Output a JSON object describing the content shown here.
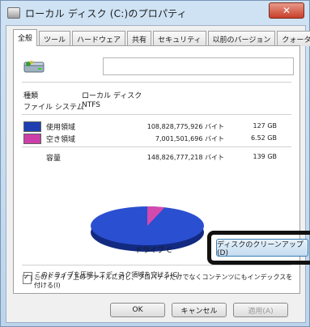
{
  "window": {
    "title": "ローカル ディスク (C:)のプロパティ",
    "close_label": "✕"
  },
  "tabs": [
    {
      "label": "全般",
      "active": true
    },
    {
      "label": "ツール",
      "active": false
    },
    {
      "label": "ハードウェア",
      "active": false
    },
    {
      "label": "共有",
      "active": false
    },
    {
      "label": "セキュリティ",
      "active": false
    },
    {
      "label": "以前のバージョン",
      "active": false
    },
    {
      "label": "クォータ",
      "active": false
    }
  ],
  "general": {
    "name_value": "",
    "type_label": "種類",
    "type_value": "ローカル ディスク",
    "fs_label": "ファイル システム",
    "fs_value": "NTFS",
    "used": {
      "label": "使用領域",
      "bytes": "108,828,775,926 バイト",
      "size": "127 GB",
      "color": "#1f3fb0"
    },
    "free": {
      "label": "空き領域",
      "bytes": "7,001,501,696 バイト",
      "size": "6.52 GB",
      "color": "#cc3fa8"
    },
    "capacity": {
      "label": "容量",
      "bytes": "148,826,777,218 バイト",
      "size": "139 GB"
    },
    "drive_label": "ドライブ C",
    "cleanup_button": "ディスクのクリーンアップ(D)",
    "pie": {
      "used_fraction": 0.95,
      "free_fraction": 0.05
    }
  },
  "options": {
    "compress": {
      "label": "このドライブを圧縮してディスク領域を空ける(C)",
      "checked": false
    },
    "index": {
      "label": "このドライブ上のファイルに対し、プロパティだけでなくコンテンツにもインデックスを付ける(I)",
      "checked": true
    }
  },
  "footer": {
    "ok": "OK",
    "cancel": "キャンセル",
    "apply": "適用(A)"
  }
}
